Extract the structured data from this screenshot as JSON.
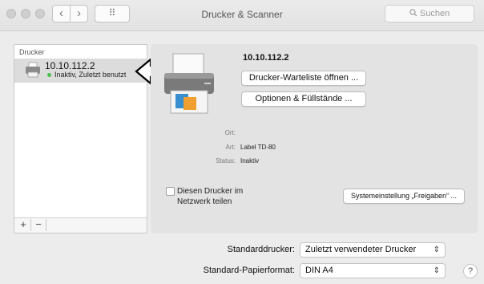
{
  "window": {
    "title": "Drucker & Scanner",
    "search_placeholder": "Suchen",
    "back_glyph": "‹",
    "forward_glyph": "›",
    "grid_glyph": "⠿"
  },
  "sidebar": {
    "heading": "Drucker",
    "items": [
      {
        "name": "10.10.112.2",
        "status": "Inaktiv, Zuletzt benutzt"
      }
    ],
    "add_label": "+",
    "remove_label": "−"
  },
  "details": {
    "printer_name": "10.10.112.2",
    "queue_button": "Drucker-Warteliste öffnen ...",
    "options_button": "Optionen & Füllstände ...",
    "fields": [
      {
        "key": "Ort:",
        "value": ""
      },
      {
        "key": "Art:",
        "value": "Label TD-80"
      },
      {
        "key": "Status:",
        "value": "Inaktiv"
      }
    ],
    "share_checkbox_label": "Diesen Drucker im Netzwerk teilen",
    "share_checked": false,
    "sharing_prefs_button": "Systemeinstellung „Freigaben“ ..."
  },
  "footer": {
    "default_printer_label": "Standarddrucker:",
    "default_printer_value": "Zuletzt verwendeter Drucker",
    "paper_label": "Standard-Papierformat:",
    "paper_value": "DIN A4",
    "help_glyph": "?"
  },
  "colors": {
    "status_dot": "#4cc24c",
    "selection": "#dcdcdc"
  }
}
